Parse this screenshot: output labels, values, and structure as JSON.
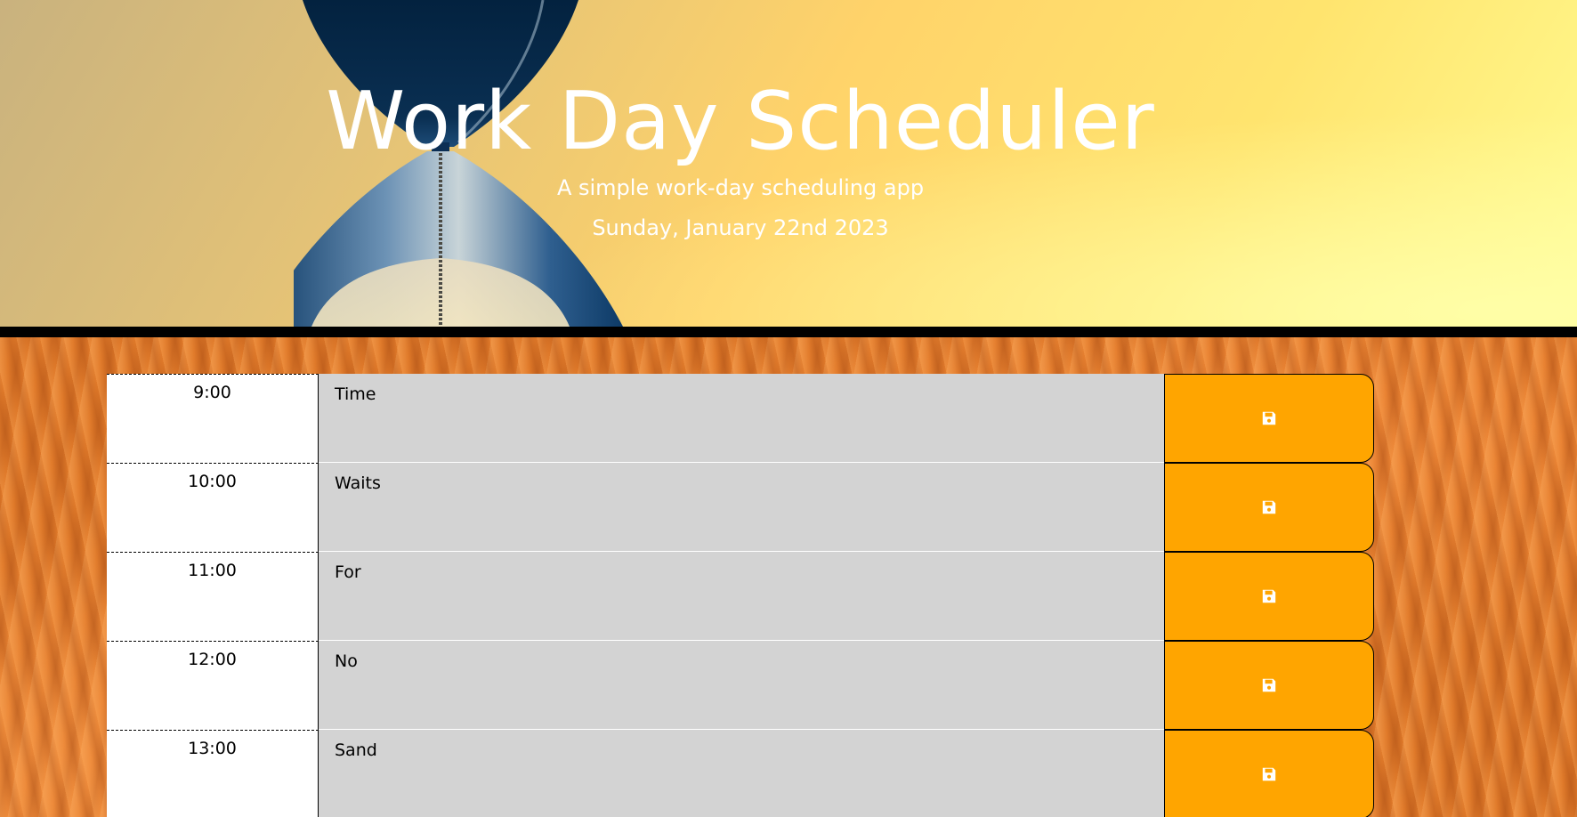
{
  "header": {
    "title": "Work Day Scheduler",
    "subtitle": "A simple work-day scheduling app",
    "current_day": "Sunday, January 22nd 2023"
  },
  "time_blocks": [
    {
      "hour": "9:00",
      "text": "Time"
    },
    {
      "hour": "10:00",
      "text": "Waits"
    },
    {
      "hour": "11:00",
      "text": "For"
    },
    {
      "hour": "12:00",
      "text": "No"
    },
    {
      "hour": "13:00",
      "text": "Sand"
    }
  ],
  "icons": {
    "save": "floppy-disk-icon"
  },
  "colors": {
    "save_button": "#ffa500",
    "past": "#d3d3d3",
    "hour_bg": "#ffffff",
    "header_border": "#000000"
  }
}
